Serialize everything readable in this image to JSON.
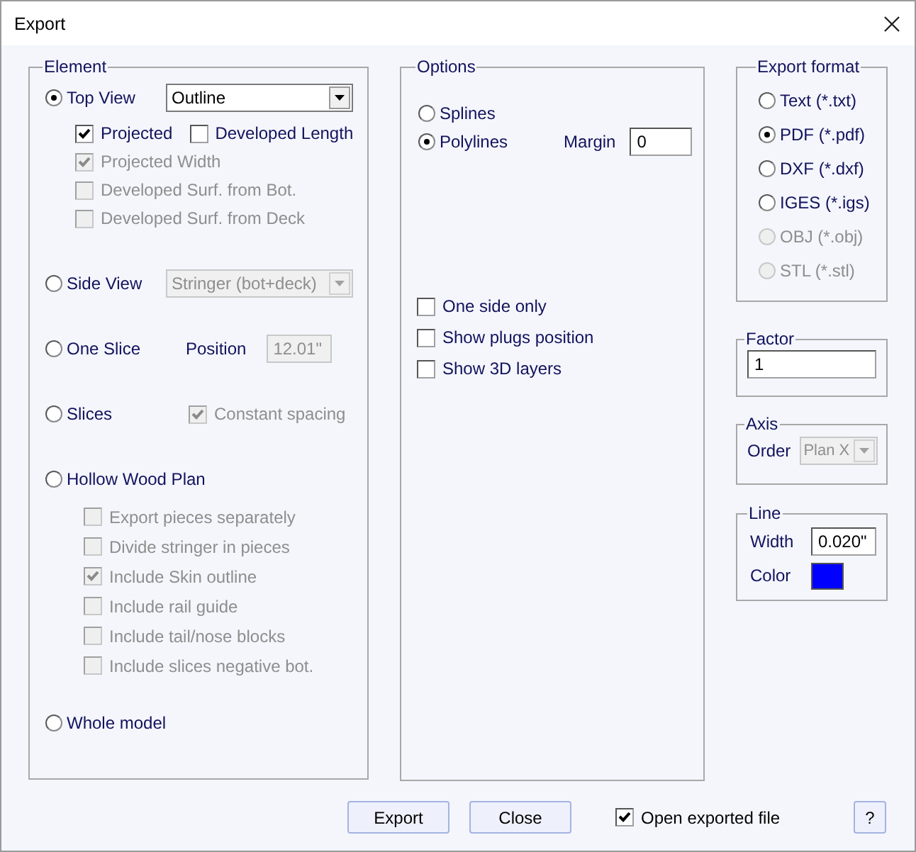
{
  "window": {
    "title": "Export"
  },
  "element": {
    "title": "Element",
    "options": [
      {
        "label": "Top View",
        "selected": true,
        "control": {
          "kind": "dropdown",
          "value": "Outline",
          "disabled": false
        },
        "rows": [
          {
            "checkboxes": [
              {
                "label": "Projected",
                "checked": true,
                "disabled": false
              },
              {
                "label": "Developed Length",
                "checked": false,
                "disabled": false
              }
            ]
          },
          {
            "checkboxes": [
              {
                "label": "Projected Width",
                "checked": true,
                "disabled": true
              }
            ]
          },
          {
            "checkboxes": [
              {
                "label": "Developed Surf. from Bot.",
                "checked": false,
                "disabled": true
              }
            ]
          },
          {
            "checkboxes": [
              {
                "label": "Developed Surf. from Deck",
                "checked": false,
                "disabled": true
              }
            ]
          }
        ]
      },
      {
        "label": "Side View",
        "selected": false,
        "control": {
          "kind": "dropdown",
          "value": "Stringer (bot+deck)",
          "disabled": true
        }
      },
      {
        "label": "One Slice",
        "selected": false,
        "control": {
          "kind": "field",
          "label": "Position",
          "value": "12.01\"",
          "disabled": true
        }
      },
      {
        "label": "Slices",
        "selected": false,
        "control": {
          "kind": "checkbox",
          "label": "Constant spacing",
          "checked": true,
          "disabled": true
        }
      },
      {
        "label": "Hollow Wood Plan",
        "selected": false,
        "rows": [
          {
            "checkboxes": [
              {
                "label": "Export pieces separately",
                "checked": false,
                "disabled": true
              }
            ]
          },
          {
            "checkboxes": [
              {
                "label": "Divide stringer in pieces",
                "checked": false,
                "disabled": true
              }
            ]
          },
          {
            "checkboxes": [
              {
                "label": "Include Skin outline",
                "checked": true,
                "disabled": true
              }
            ]
          },
          {
            "checkboxes": [
              {
                "label": "Include rail guide",
                "checked": false,
                "disabled": true
              }
            ]
          },
          {
            "checkboxes": [
              {
                "label": "Include tail/nose blocks",
                "checked": false,
                "disabled": true
              }
            ]
          },
          {
            "checkboxes": [
              {
                "label": "Include slices negative bot.",
                "checked": false,
                "disabled": true
              }
            ]
          }
        ]
      },
      {
        "label": "Whole model",
        "selected": false
      }
    ]
  },
  "options": {
    "title": "Options",
    "curve_types": [
      {
        "label": "Splines",
        "selected": false
      },
      {
        "label": "Polylines",
        "selected": true
      }
    ],
    "margin": {
      "label": "Margin",
      "value": "0"
    },
    "checkboxes": [
      {
        "label": "One side only",
        "checked": false
      },
      {
        "label": "Show plugs position",
        "checked": false
      },
      {
        "label": "Show 3D layers",
        "checked": false
      }
    ]
  },
  "export_format": {
    "title": "Export format",
    "formats": [
      {
        "label": "Text (*.txt)",
        "selected": false,
        "disabled": false
      },
      {
        "label": "PDF (*.pdf)",
        "selected": true,
        "disabled": false
      },
      {
        "label": "DXF (*.dxf)",
        "selected": false,
        "disabled": false
      },
      {
        "label": "IGES (*.igs)",
        "selected": false,
        "disabled": false
      },
      {
        "label": "OBJ (*.obj)",
        "selected": false,
        "disabled": true
      },
      {
        "label": "STL (*.stl)",
        "selected": false,
        "disabled": true
      }
    ]
  },
  "factor": {
    "title": "Factor",
    "value": "1"
  },
  "axis": {
    "title": "Axis",
    "label": "Order",
    "value": "Plan X",
    "disabled": true
  },
  "line": {
    "title": "Line",
    "width_label": "Width",
    "width_value": "0.020\"",
    "color_label": "Color",
    "color": "#0000ff"
  },
  "buttons": [
    {
      "label": "Export"
    },
    {
      "label": "Close"
    }
  ],
  "open_exported_file": {
    "label": "Open exported file",
    "checked": true
  },
  "help_button": {
    "label": "?"
  }
}
